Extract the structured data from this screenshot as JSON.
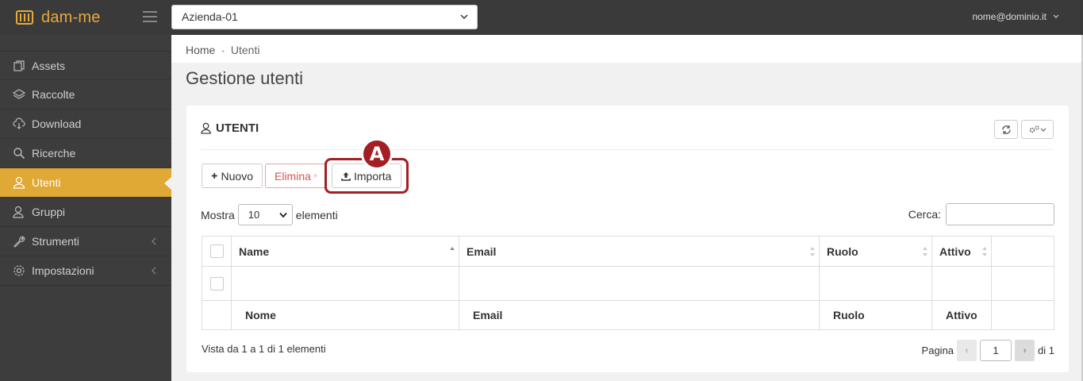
{
  "app": {
    "brand": "dam-me",
    "company_select": "Azienda-01",
    "user_menu": "nome@dominio.it",
    "accent": "#e0a834",
    "highlight": "#a31f24"
  },
  "sidebar": {
    "items": [
      {
        "label": "Assets",
        "icon": "copy-icon"
      },
      {
        "label": "Raccolte",
        "icon": "layers-icon"
      },
      {
        "label": "Download",
        "icon": "cloud-download-icon"
      },
      {
        "label": "Ricerche",
        "icon": "search-icon"
      },
      {
        "label": "Utenti",
        "icon": "user-icon",
        "active": true
      },
      {
        "label": "Gruppi",
        "icon": "users-icon"
      },
      {
        "label": "Strumenti",
        "icon": "wrench-icon"
      },
      {
        "label": "Impostazioni",
        "icon": "gear-icon"
      }
    ]
  },
  "breadcrumb": {
    "home": "Home",
    "current": "Utenti"
  },
  "page": {
    "title": "Gestione utenti"
  },
  "card": {
    "title": "UTENTI",
    "buttons": {
      "new": "Nuovo",
      "delete": "Elimina",
      "import": "Importa"
    },
    "marker": "A",
    "show_prefix": "Mostra",
    "show_value": "10",
    "show_suffix": "elementi",
    "search_label": "Cerca:",
    "search_value": "",
    "table": {
      "headers": [
        "Name",
        "Email",
        "Ruolo",
        "Attivo"
      ],
      "footers": [
        "Nome",
        "Email",
        "Ruolo",
        "Attivo"
      ]
    },
    "info": "Vista da 1 a 1 di 1  elementi",
    "pager": {
      "label": "Pagina",
      "page": "1",
      "total": "di 1"
    }
  }
}
